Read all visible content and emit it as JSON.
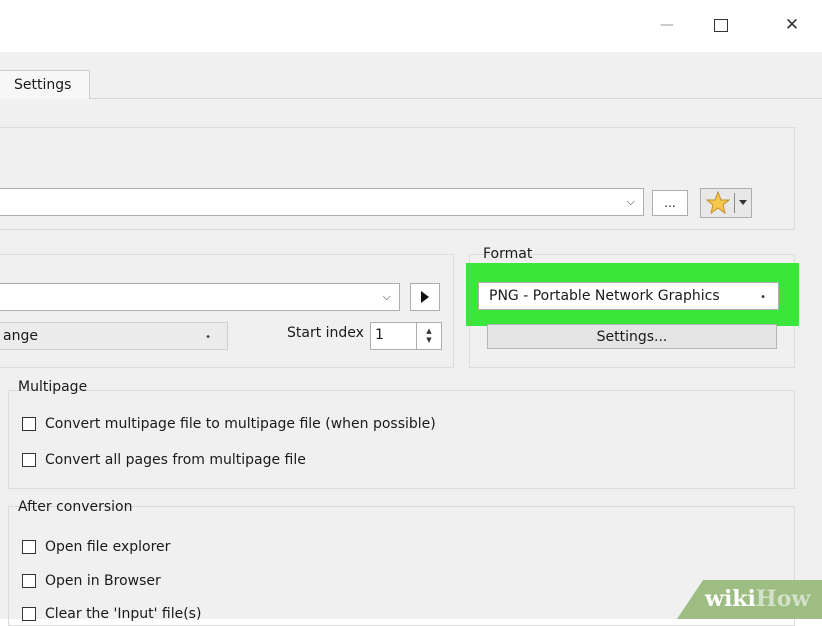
{
  "window": {
    "minimize_glyph": "—",
    "maximize_glyph": "☐",
    "close_glyph": "✕"
  },
  "tabs": [
    {
      "label": "Settings"
    }
  ],
  "output": {
    "browse_label": "...",
    "combo_arrow": "⌵",
    "favorite_icon": "star-icon"
  },
  "naming": {
    "range_value": "ange",
    "start_index_label": "Start index",
    "start_index_value": "1"
  },
  "format": {
    "label": "Format",
    "selected": "PNG - Portable Network Graphics",
    "settings_button": "Settings..."
  },
  "multipage": {
    "title": "Multipage",
    "options": [
      {
        "label": "Convert multipage file to multipage file (when possible)",
        "checked": false
      },
      {
        "label": "Convert all pages from multipage file",
        "checked": false
      }
    ]
  },
  "after_conversion": {
    "title": "After conversion",
    "options": [
      {
        "label": "Open file explorer",
        "checked": false
      },
      {
        "label": "Open in Browser",
        "checked": false
      },
      {
        "label": "Clear the 'Input' file(s)",
        "checked": false
      }
    ]
  },
  "watermark": {
    "part1": "wiki",
    "part2": "How"
  },
  "colors": {
    "highlight": "#39e639",
    "watermark_bg": "#9dbd83"
  }
}
